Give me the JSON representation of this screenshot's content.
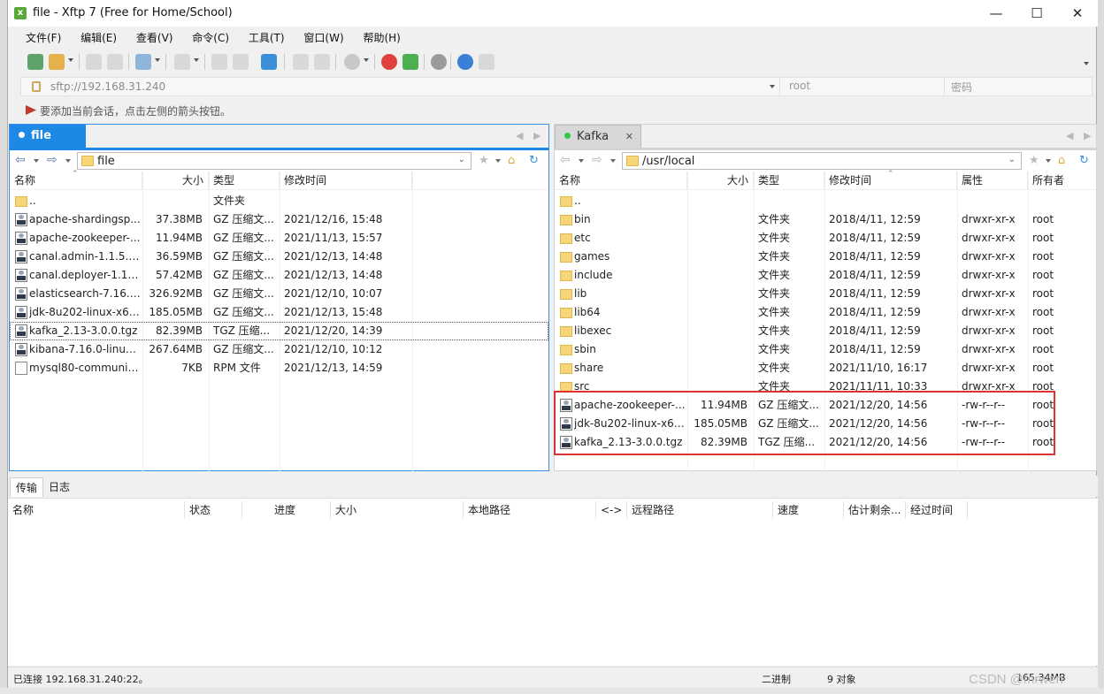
{
  "window": {
    "title": "file - Xftp 7 (Free for Home/School)",
    "minimize": "—",
    "maximize": "☐",
    "close": "✕"
  },
  "menu": [
    "文件(F)",
    "编辑(E)",
    "查看(V)",
    "命令(C)",
    "工具(T)",
    "窗口(W)",
    "帮助(H)"
  ],
  "address": {
    "url": "sftp://192.168.31.240",
    "user_placeholder": "root",
    "password_placeholder": "密码"
  },
  "hint": "要添加当前会话，点击左侧的箭头按钮。",
  "left_pane": {
    "tab_label": "file",
    "path": "file",
    "columns": [
      "名称",
      "大小",
      "类型",
      "修改时间"
    ],
    "rows": [
      {
        "icon": "folder-icon",
        "name": "..",
        "size": "",
        "type": "文件夹",
        "mtime": ""
      },
      {
        "icon": "gz-archive-icon",
        "name": "apache-shardingsp...",
        "size": "37.38MB",
        "type": "GZ 压缩文...",
        "mtime": "2021/12/16, 15:48"
      },
      {
        "icon": "gz-archive-icon",
        "name": "apache-zookeeper-...",
        "size": "11.94MB",
        "type": "GZ 压缩文...",
        "mtime": "2021/11/13, 15:57"
      },
      {
        "icon": "gz-archive-icon",
        "name": "canal.admin-1.1.5.ta...",
        "size": "36.59MB",
        "type": "GZ 压缩文...",
        "mtime": "2021/12/13, 14:48"
      },
      {
        "icon": "gz-archive-icon",
        "name": "canal.deployer-1.1....",
        "size": "57.42MB",
        "type": "GZ 压缩文...",
        "mtime": "2021/12/13, 14:48"
      },
      {
        "icon": "gz-archive-icon",
        "name": "elasticsearch-7.16.0...",
        "size": "326.92MB",
        "type": "GZ 压缩文...",
        "mtime": "2021/12/10, 10:07"
      },
      {
        "icon": "gz-archive-icon",
        "name": "jdk-8u202-linux-x64...",
        "size": "185.05MB",
        "type": "GZ 压缩文...",
        "mtime": "2021/12/13, 15:48"
      },
      {
        "icon": "gz-archive-icon",
        "name": "kafka_2.13-3.0.0.tgz",
        "size": "82.39MB",
        "type": "TGZ 压缩...",
        "mtime": "2021/12/20, 14:39"
      },
      {
        "icon": "gz-archive-icon",
        "name": "kibana-7.16.0-linux-...",
        "size": "267.64MB",
        "type": "GZ 压缩文...",
        "mtime": "2021/12/10, 10:12"
      },
      {
        "icon": "document-icon",
        "name": "mysql80-communit...",
        "size": "7KB",
        "type": "RPM 文件",
        "mtime": "2021/12/13, 14:59"
      }
    ]
  },
  "right_pane": {
    "tab_label": "Kafka",
    "path": "/usr/local",
    "columns": [
      "名称",
      "大小",
      "类型",
      "修改时间",
      "属性",
      "所有者"
    ],
    "rows": [
      {
        "icon": "folder-icon",
        "name": "..",
        "size": "",
        "type": "",
        "mtime": "",
        "perm": "",
        "owner": ""
      },
      {
        "icon": "folder-icon",
        "name": "bin",
        "size": "",
        "type": "文件夹",
        "mtime": "2018/4/11, 12:59",
        "perm": "drwxr-xr-x",
        "owner": "root"
      },
      {
        "icon": "folder-icon",
        "name": "etc",
        "size": "",
        "type": "文件夹",
        "mtime": "2018/4/11, 12:59",
        "perm": "drwxr-xr-x",
        "owner": "root"
      },
      {
        "icon": "folder-icon",
        "name": "games",
        "size": "",
        "type": "文件夹",
        "mtime": "2018/4/11, 12:59",
        "perm": "drwxr-xr-x",
        "owner": "root"
      },
      {
        "icon": "folder-icon",
        "name": "include",
        "size": "",
        "type": "文件夹",
        "mtime": "2018/4/11, 12:59",
        "perm": "drwxr-xr-x",
        "owner": "root"
      },
      {
        "icon": "folder-icon",
        "name": "lib",
        "size": "",
        "type": "文件夹",
        "mtime": "2018/4/11, 12:59",
        "perm": "drwxr-xr-x",
        "owner": "root"
      },
      {
        "icon": "folder-icon",
        "name": "lib64",
        "size": "",
        "type": "文件夹",
        "mtime": "2018/4/11, 12:59",
        "perm": "drwxr-xr-x",
        "owner": "root"
      },
      {
        "icon": "folder-icon",
        "name": "libexec",
        "size": "",
        "type": "文件夹",
        "mtime": "2018/4/11, 12:59",
        "perm": "drwxr-xr-x",
        "owner": "root"
      },
      {
        "icon": "folder-icon",
        "name": "sbin",
        "size": "",
        "type": "文件夹",
        "mtime": "2018/4/11, 12:59",
        "perm": "drwxr-xr-x",
        "owner": "root"
      },
      {
        "icon": "folder-icon",
        "name": "share",
        "size": "",
        "type": "文件夹",
        "mtime": "2021/11/10, 16:17",
        "perm": "drwxr-xr-x",
        "owner": "root"
      },
      {
        "icon": "folder-icon",
        "name": "src",
        "size": "",
        "type": "文件夹",
        "mtime": "2021/11/11, 10:33",
        "perm": "drwxr-xr-x",
        "owner": "root"
      },
      {
        "icon": "gz-archive-icon",
        "name": "apache-zookeeper-...",
        "size": "11.94MB",
        "type": "GZ 压缩文...",
        "mtime": "2021/12/20, 14:56",
        "perm": "-rw-r--r--",
        "owner": "root"
      },
      {
        "icon": "gz-archive-icon",
        "name": "jdk-8u202-linux-x64...",
        "size": "185.05MB",
        "type": "GZ 压缩文...",
        "mtime": "2021/12/20, 14:56",
        "perm": "-rw-r--r--",
        "owner": "root"
      },
      {
        "icon": "gz-archive-icon",
        "name": "kafka_2.13-3.0.0.tgz",
        "size": "82.39MB",
        "type": "TGZ 压缩...",
        "mtime": "2021/12/20, 14:56",
        "perm": "-rw-r--r--",
        "owner": "root"
      }
    ]
  },
  "transfer": {
    "tabs": [
      "传输",
      "日志"
    ],
    "columns": [
      "名称",
      "状态",
      "进度",
      "大小",
      "本地路径",
      "<->",
      "远程路径",
      "速度",
      "估计剩余...",
      "经过时间"
    ]
  },
  "status": {
    "connection": "已连接 192.168.31.240:22。",
    "mode": "二进制",
    "objects": "9 对象",
    "size": "165.34MB"
  },
  "watermark": "CSDN @mrwen",
  "colors": {
    "active_tab": "#1e88e5",
    "highlight_box": "#e03131",
    "folder": "#f7d67a"
  }
}
